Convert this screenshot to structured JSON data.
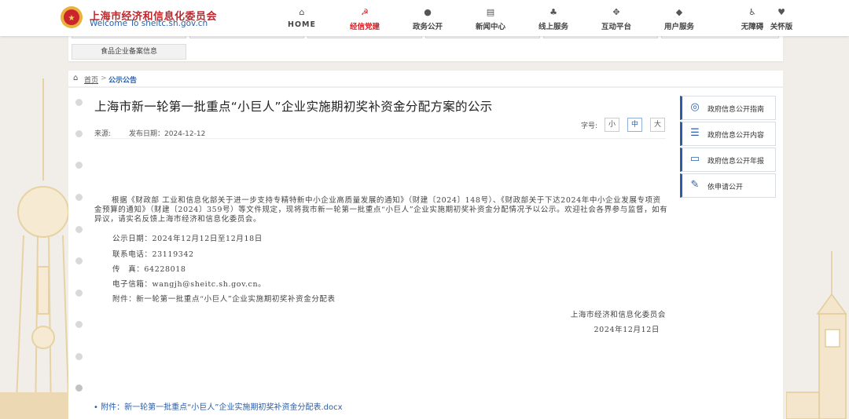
{
  "header": {
    "logo_title": "上海市经济和信息化委员会",
    "logo_subtitle": "Welcome To sheitc.sh.gov.cn",
    "nav": [
      {
        "label": "HOME",
        "icon": "home-icon",
        "glyph": "⌂"
      },
      {
        "label": "经信党建",
        "icon": "party-emblem-icon",
        "glyph": "☭",
        "active": true
      },
      {
        "label": "政务公开",
        "icon": "chat-icon",
        "glyph": "●"
      },
      {
        "label": "新闻中心",
        "icon": "news-icon",
        "glyph": "▤"
      },
      {
        "label": "线上服务",
        "icon": "service-icon",
        "glyph": "♣"
      },
      {
        "label": "互动平台",
        "icon": "interaction-icon",
        "glyph": "✥"
      },
      {
        "label": "用户服务",
        "icon": "user-service-icon",
        "glyph": "◆"
      },
      {
        "label": "无障碍",
        "icon": "accessibility-icon",
        "glyph": "♿"
      },
      {
        "label": "关怀版",
        "icon": "care-icon",
        "glyph": "♥"
      }
    ],
    "accent_color": "#d1242a"
  },
  "top_strip": {
    "button_label": "食品企业备案信息"
  },
  "breadcrumb": {
    "home": "首页",
    "separator": ">",
    "current": "公示公告"
  },
  "article": {
    "title": "上海市新一轮第一批重点“小巨人”企业实施期初奖补资金分配方案的公示",
    "source_label": "来源:",
    "date_label": "发布日期：2024-12-12",
    "font_size_label": "字号:",
    "font_sizes": [
      "小",
      "中",
      "大"
    ],
    "paragraph": "根据《财政部 工业和信息化部关于进一步支持专精特新中小企业高质量发展的通知》（财建〔2024〕148号）、《财政部关于下达2024年中小企业发展专项资金预算的通知》（财建〔2024〕359号）等文件规定，现将我市新一轮第一批重点“小巨人”企业实施期初奖补资金分配情况予以公示。欢迎社会各界参与监督，如有异议，请实名反馈上海市经济和信息化委员会。",
    "lines": [
      "公示日期：2024年12月12日至12月18日",
      "联系电话：23119342",
      "传　真：64228018",
      "电子信箱：wangjh@sheitc.sh.gov.cn。",
      "附件：新一轮第一批重点“小巨人”企业实施期初奖补资金分配表"
    ],
    "signature_org": "上海市经济和信息化委员会",
    "signature_date": "2024年12月12日",
    "attachment_link": "• 附件：新一轮第一批重点“小巨人”企业实施期初奖补资金分配表.docx"
  },
  "sidebar": [
    {
      "label": "政府信息公开指南",
      "icon": "compass-icon",
      "glyph": "◎"
    },
    {
      "label": "政府信息公开内容",
      "icon": "list-icon",
      "glyph": "☰"
    },
    {
      "label": "政府信息公开年报",
      "icon": "report-icon",
      "glyph": "▭"
    },
    {
      "label": "依申请公开",
      "icon": "apply-form-icon",
      "glyph": "✎"
    }
  ]
}
